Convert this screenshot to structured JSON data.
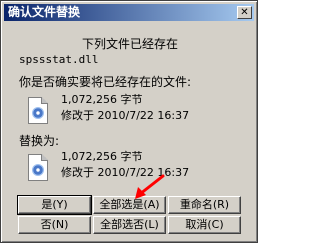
{
  "window": {
    "title": "确认文件替换",
    "close_glyph": "✕"
  },
  "dialog": {
    "header": "下列文件已经存在",
    "filename": "spssstat.dll",
    "question": "你是否确实要将已经存在的文件:",
    "existing": {
      "size": "1,072,256 字节",
      "modified": "修改于 2010/7/22 16:37"
    },
    "replace_label": "替换为:",
    "replacement": {
      "size": "1,072,256 字节",
      "modified": "修改于 2010/7/22 16:37"
    }
  },
  "buttons": {
    "yes": "是(Y)",
    "yes_all": "全部选是(A)",
    "rename": "重命名(R)",
    "no": "否(N)",
    "no_all": "全部选否(L)",
    "cancel": "取消(C)"
  },
  "icons": {
    "file": "dll-file-icon",
    "annotation": "red-arrow"
  },
  "colors": {
    "arrow": "#ff0000",
    "titlebar_start": "#0a246a",
    "titlebar_end": "#a6caf0"
  }
}
